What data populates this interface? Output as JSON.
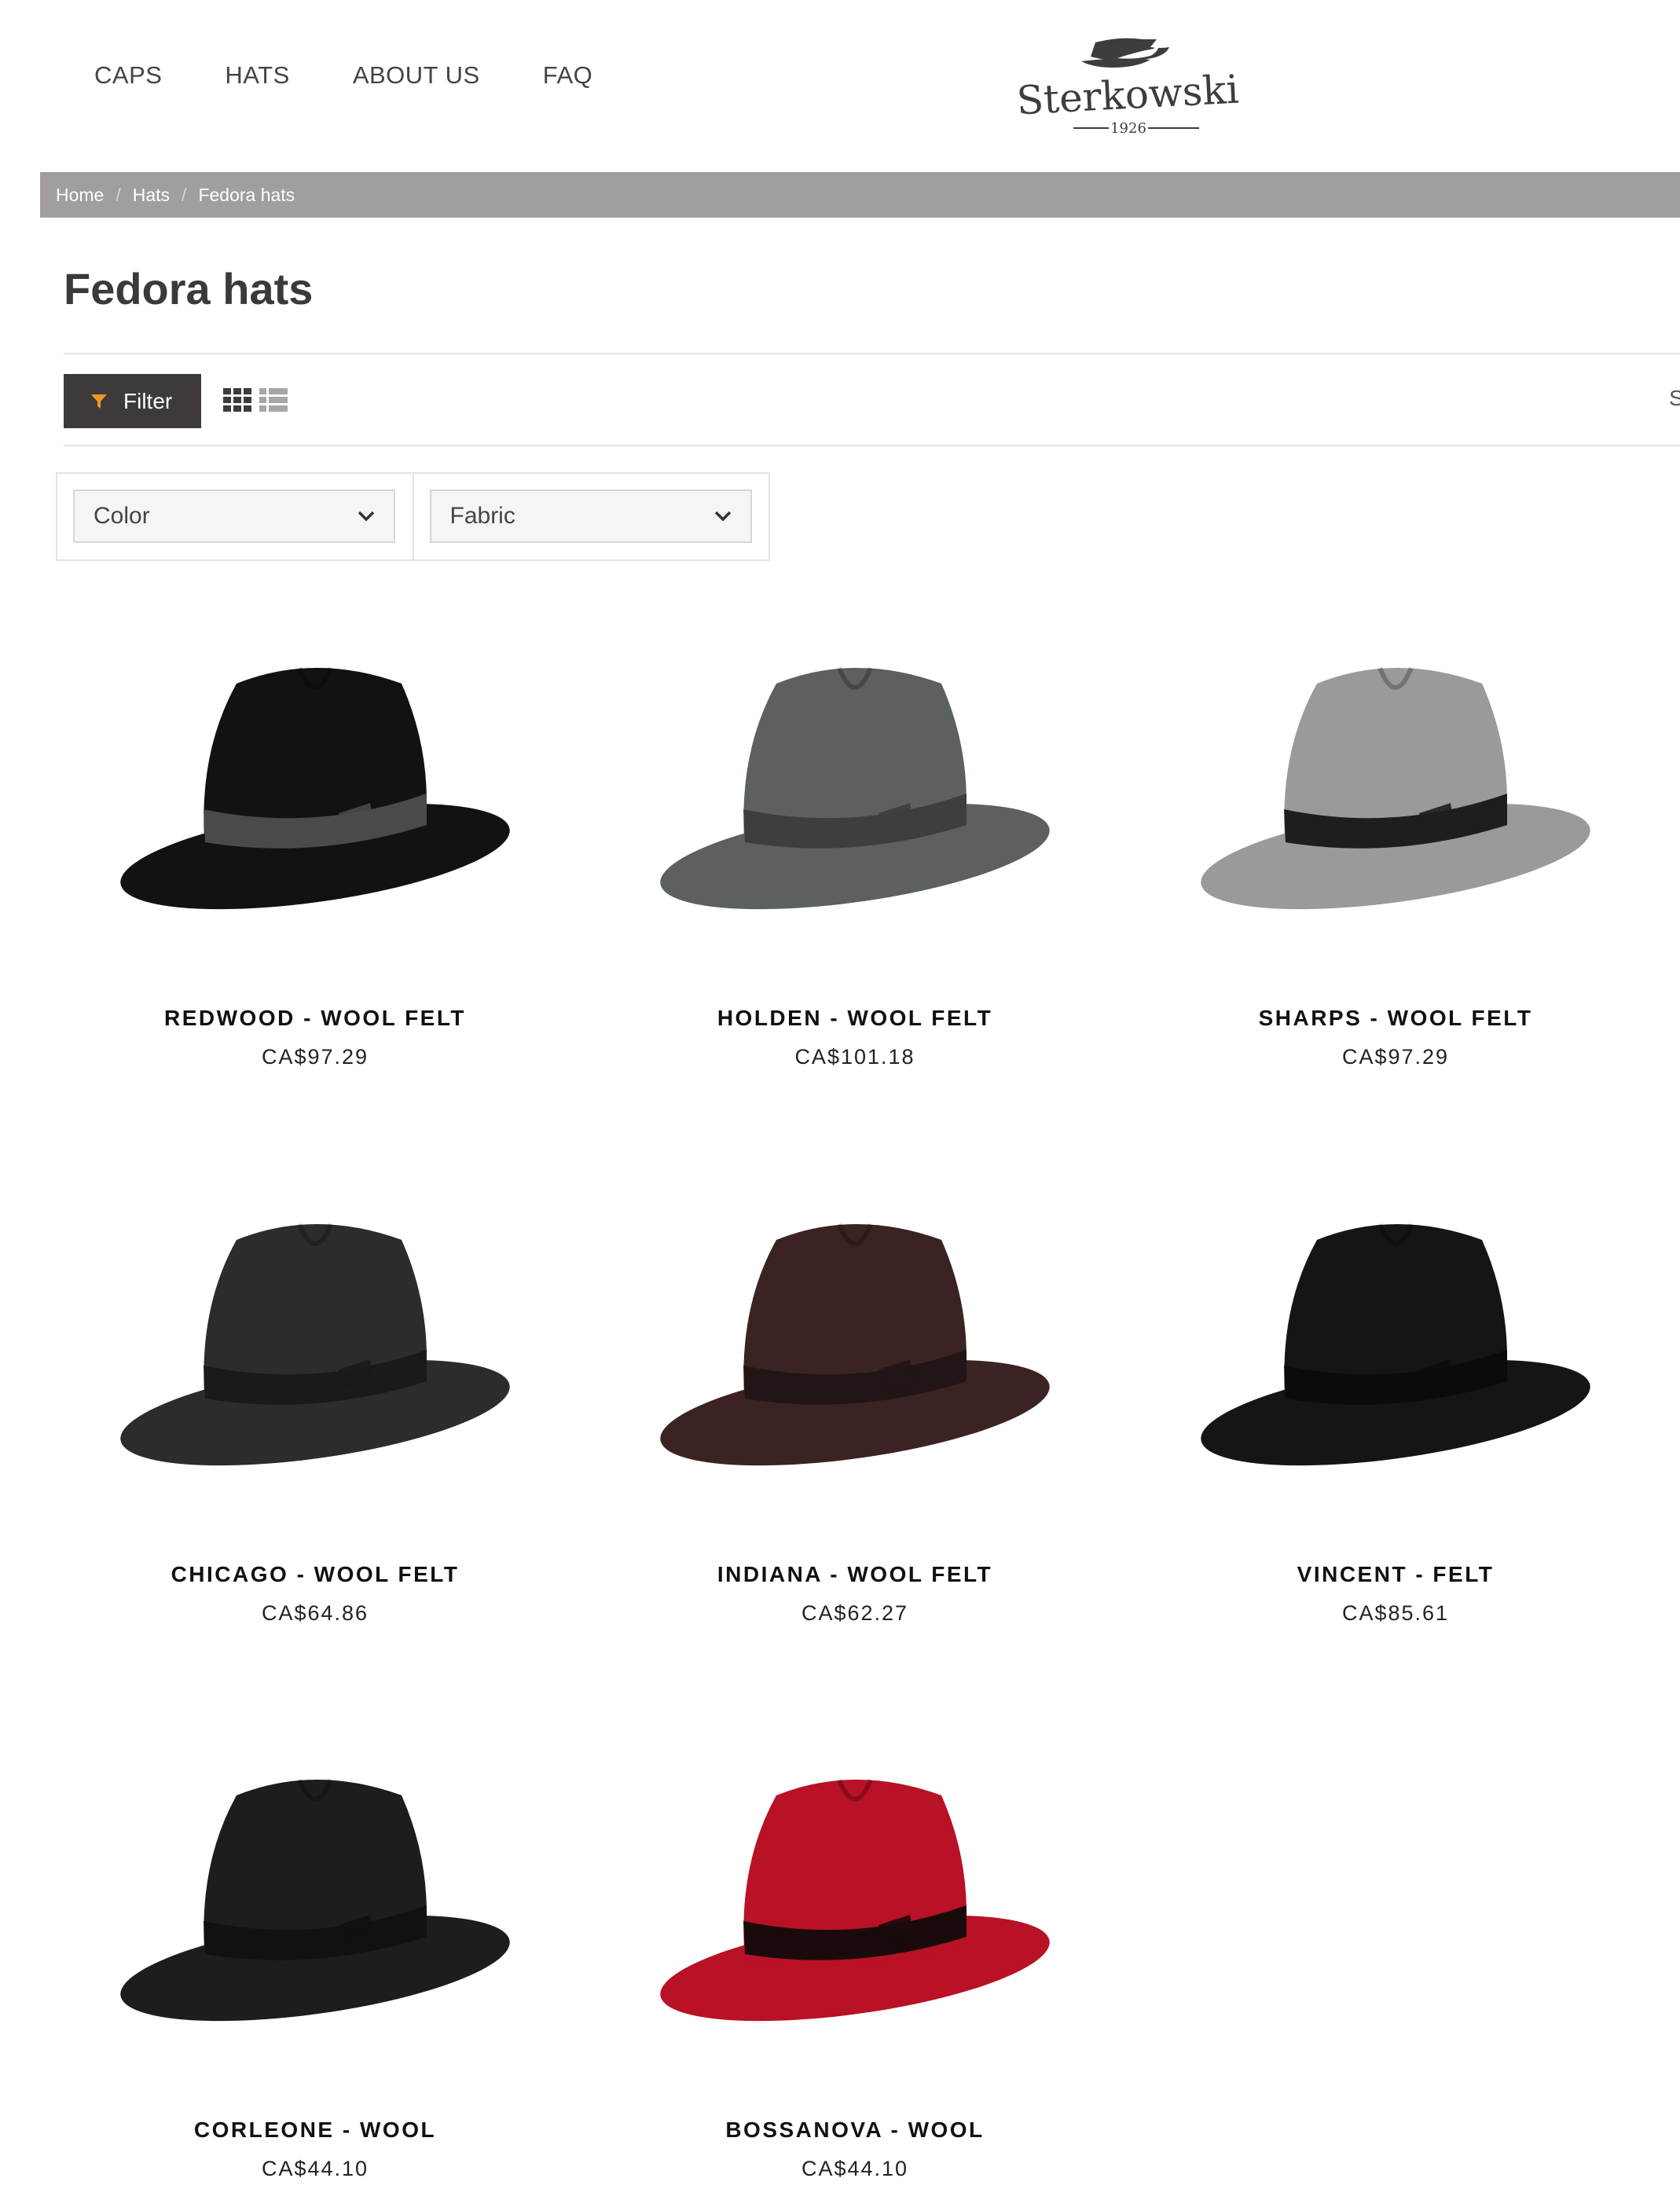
{
  "nav": {
    "items": [
      {
        "label": "CAPS"
      },
      {
        "label": "HATS"
      },
      {
        "label": "ABOUT US"
      },
      {
        "label": "FAQ"
      }
    ]
  },
  "logo": {
    "wordmark": "Sterkowski",
    "year": "1926"
  },
  "breadcrumb": {
    "items": [
      "Home",
      "Hats",
      "Fedora hats"
    ],
    "separator": "/"
  },
  "page": {
    "title": "Fedora hats"
  },
  "toolbar": {
    "filter_label": "Filter",
    "filter_icon_color": "#f0961e",
    "sort_partial": "S"
  },
  "facets": {
    "color": {
      "label": "Color"
    },
    "fabric": {
      "label": "Fabric"
    }
  },
  "products": [
    {
      "name": "REDWOOD - WOOL FELT",
      "price": "CA$97.29",
      "hat_color": "#121212",
      "band_color": "#4a4a4a"
    },
    {
      "name": "HOLDEN - WOOL FELT",
      "price": "CA$101.18",
      "hat_color": "#5d615e",
      "band_color": "#3d3f3e"
    },
    {
      "name": "SHARPS - WOOL FELT",
      "price": "CA$97.29",
      "hat_color": "#9b9a9b",
      "band_color": "#1e1e1e"
    },
    {
      "name": "CHICAGO - WOOL FELT",
      "price": "CA$64.86",
      "hat_color": "#2c2c2e",
      "band_color": "#1a1a1a"
    },
    {
      "name": "INDIANA - WOOL FELT",
      "price": "CA$62.27",
      "hat_color": "#3b2324",
      "band_color": "#221516"
    },
    {
      "name": "VINCENT - FELT",
      "price": "CA$85.61",
      "hat_color": "#151515",
      "band_color": "#0b0b0b"
    },
    {
      "name": "CORLEONE - WOOL",
      "price": "CA$44.10",
      "hat_color": "#1d1d1d",
      "band_color": "#111111"
    },
    {
      "name": "BOSSANOVA - WOOL",
      "price": "CA$44.10",
      "hat_color": "#b91125",
      "band_color": "#1a0a0c"
    }
  ]
}
